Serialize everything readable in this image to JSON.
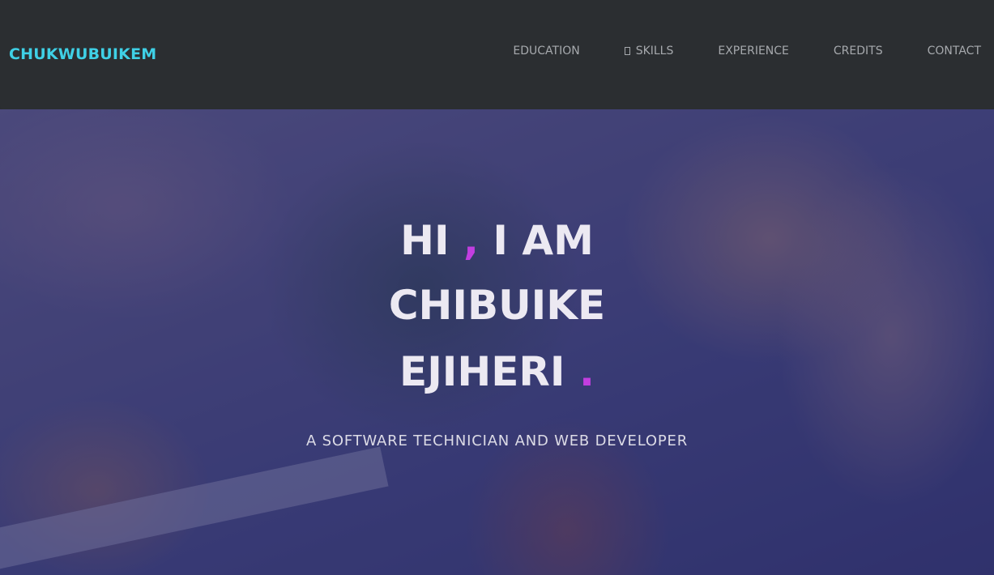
{
  "navbar": {
    "brand": "CHUKWUBUIKEM",
    "items": [
      {
        "label": "EDUCATION"
      },
      {
        "label": "SKILLS"
      },
      {
        "label": "EXPERIENCE"
      },
      {
        "label": "CREDITS"
      },
      {
        "label": "CONTACT"
      }
    ]
  },
  "hero": {
    "line1_a": "HI",
    "line1_comma": ",",
    "line1_b": "I AM",
    "line2": "CHIBUIKE",
    "line3": "EJIHERI",
    "line3_dot": ".",
    "subtitle": "A SOFTWARE TECHNICIAN AND WEB DEVELOPER"
  },
  "colors": {
    "brand": "#3fd0e6",
    "accent": "#c23ee0",
    "navbar_bg": "#2b2e31"
  }
}
